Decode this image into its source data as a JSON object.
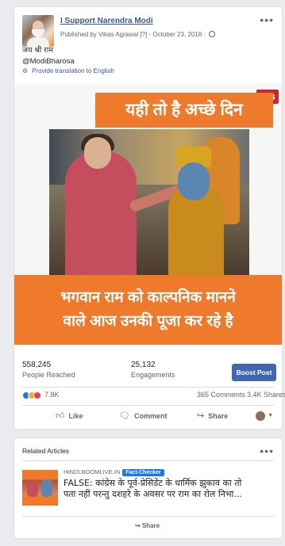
{
  "post": {
    "page_name": "I Support Narendra Modi",
    "published_by": "Published by Vikas Agrawal [?] · October 23, 2018 ·",
    "text_line1": "जय श्री राम",
    "text_line2": "@ModiBharosa",
    "translate_label": "Provide translation to English",
    "image": {
      "logo": "MB",
      "top_banner": "यही तो है अच्छे दिन",
      "bottom_banner_line1": "भगवान राम को काल्पनिक मानने",
      "bottom_banner_line2": "वाले आज उनकी पूजा कर रहे है"
    },
    "stats": {
      "reached_value": "558,245",
      "reached_label": "People Reached",
      "engagements_value": "25,132",
      "engagements_label": "Engagements",
      "boost_label": "Boost Post"
    },
    "reactions": {
      "count": "7.8K",
      "comments": "365 Comments",
      "shares": "3.4K Shares"
    },
    "actions": {
      "like": "Like",
      "comment": "Comment",
      "share": "Share"
    }
  },
  "related": {
    "title": "Related Articles",
    "source": "HINDI.BOOMLIVE.IN",
    "badge": "Fact-Checker",
    "headline_line1": "FALSE: कांग्रेस के पूर्व-प्रेसिडेंट के धार्मिक झुकाव का तो",
    "headline_line2": "पता नहीं परन्तु दशहरे के अवसर पर राम का रोल निभा...",
    "share_label": "Share"
  },
  "icons": {
    "more": "more-dots-icon",
    "globe": "globe-icon",
    "gear": "gear-icon",
    "like": "thumbs-up-icon",
    "comment": "comment-bubble-icon",
    "share": "share-arrow-icon"
  },
  "colors": {
    "brand_blue": "#4267b2",
    "link_blue": "#385898",
    "banner_orange": "#f07a2b",
    "page_bg": "#e9ebee"
  }
}
